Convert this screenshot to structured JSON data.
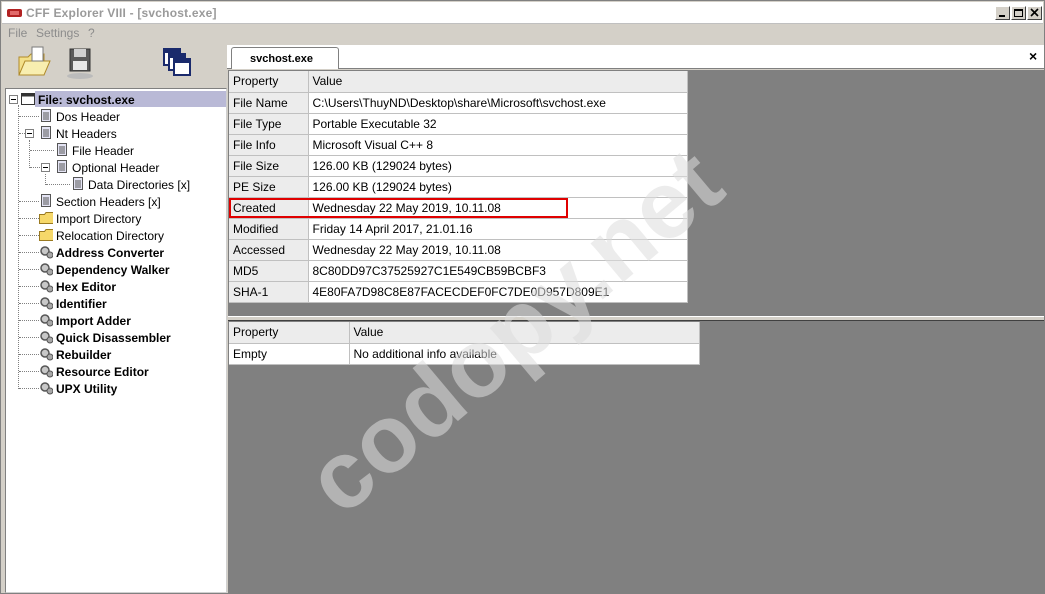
{
  "window": {
    "title": "CFF Explorer VIII - [svchost.exe]"
  },
  "menu": [
    "File",
    "Settings",
    "?"
  ],
  "toolbar": [
    {
      "icon": "open-file-icon"
    },
    {
      "icon": "save-icon"
    },
    {
      "icon": "windows-icon"
    }
  ],
  "tree": {
    "root": "File: svchost.exe",
    "items": [
      {
        "label": "Dos Header"
      },
      {
        "label": "Nt Headers"
      },
      {
        "label": "File Header"
      },
      {
        "label": "Optional Header"
      },
      {
        "label": "Data Directories [x]"
      },
      {
        "label": "Section Headers [x]"
      },
      {
        "label": "Import Directory"
      },
      {
        "label": "Relocation Directory"
      }
    ],
    "tools": [
      "Address Converter",
      "Dependency Walker",
      "Hex Editor",
      "Identifier",
      "Import Adder",
      "Quick Disassembler",
      "Rebuilder",
      "Resource Editor",
      "UPX Utility"
    ]
  },
  "tabs": {
    "active": "svchost.exe",
    "close": "×"
  },
  "file_info_table": {
    "headers": [
      "Property",
      "Value"
    ],
    "rows": [
      [
        "File Name",
        "C:\\Users\\ThuyND\\Desktop\\share\\Microsoft\\svchost.exe"
      ],
      [
        "File Type",
        "Portable Executable 32"
      ],
      [
        "File Info",
        "Microsoft Visual C++ 8"
      ],
      [
        "File Size",
        "126.00 KB (129024 bytes)"
      ],
      [
        "PE Size",
        "126.00 KB (129024 bytes)"
      ],
      [
        "Created",
        "Wednesday 22 May 2019, 10.11.08"
      ],
      [
        "Modified",
        "Friday 14 April 2017, 21.01.16"
      ],
      [
        "Accessed",
        "Wednesday 22 May 2019, 10.11.08"
      ],
      [
        "MD5",
        "8C80DD97C37525927C1E549CB59BCBF3"
      ],
      [
        "SHA-1",
        "4E80FA7D98C8E87FACECDEF0FC7DE0D957D809E1"
      ]
    ]
  },
  "extra_info_table": {
    "headers": [
      "Property",
      "Value"
    ],
    "rows": [
      [
        "Empty",
        "No additional info available"
      ]
    ]
  },
  "watermark": "codopy.net",
  "colors": {
    "highlight": "#e00000",
    "selection": "#b9b9d6",
    "workspace": "#808080"
  }
}
